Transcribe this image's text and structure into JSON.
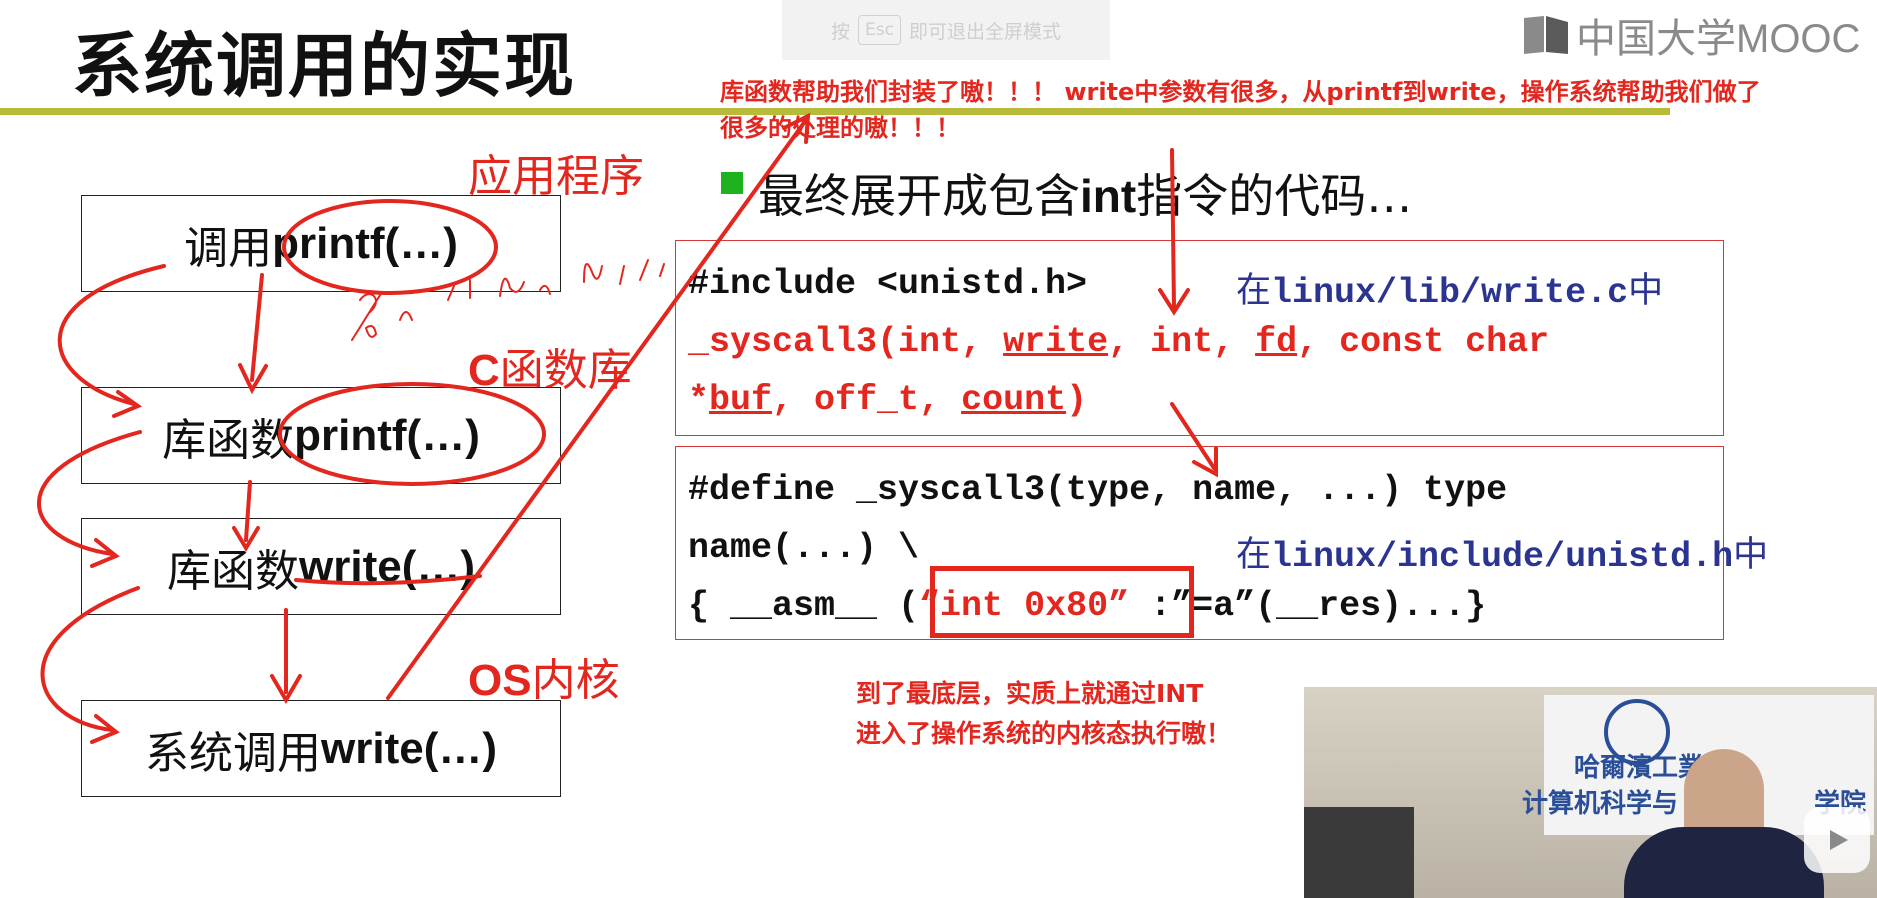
{
  "slide": {
    "title": "系统调用的实现",
    "esc_hint": {
      "prefix": "按",
      "key": "Esc",
      "suffix": "即可退出全屏模式"
    },
    "logo_text": "中国大学MOOC",
    "layer_labels": {
      "app": "应用程序",
      "lib_latin": "C",
      "lib_cn": "函数库",
      "os_latin": "OS",
      "os_cn": "内核"
    },
    "boxes": [
      {
        "cn": "调用",
        "en": "printf(…)"
      },
      {
        "cn": "库函数",
        "en": "printf(…)"
      },
      {
        "cn": "库函数",
        "en": "write(…)"
      },
      {
        "cn": "系统调用",
        "en": "write(…)"
      }
    ],
    "bullet": {
      "cn1": "最终展开成包含",
      "en": "int",
      "cn2": "指令的代码…"
    },
    "code1": {
      "line1": "#include <unistd.h>",
      "path_cn1": "在",
      "path": "linux/lib/write.c",
      "path_cn2": "中",
      "l2_a": "_syscall3(int, ",
      "l2_write": "write",
      "l2_b": ", int, ",
      "l2_fd": "fd",
      "l2_c": ", const char",
      "l3_star": "*",
      "l3_buf": "buf",
      "l3_b": ", off_t, ",
      "l3_count": "count",
      "l3_end": ")"
    },
    "code2": {
      "line1": "#define _syscall3(type, name, ...) type",
      "line2": "name(...) \\",
      "path_cn1": "在",
      "path": "linux/include/unistd.h",
      "path_cn2": "中",
      "l3_a": "{ __asm__ (",
      "l3_int": "“int 0x80”",
      "l3_b": " :”=a”(__res)...}"
    },
    "annotation_top": {
      "line1": "库函数帮助我们封装了嗷！！！ write中参数有很多，从printf到write，操作系统帮助我们做了",
      "line2": "很多的处理的嗷！！！"
    },
    "annotation_bottom": {
      "line1": "到了最底层，实质上就通过INT",
      "line2": "进入了操作系统的内核态执行嗷！"
    },
    "video": {
      "banner_top": "哈爾濱工業",
      "banner_bottom": "计算机科学与",
      "banner_bottom_end": "学院"
    }
  },
  "colors": {
    "accent_red": "#e3261e",
    "path_blue": "#2b3591",
    "title_bar": "#b8bb3a",
    "bullet_green": "#1fb21f"
  }
}
